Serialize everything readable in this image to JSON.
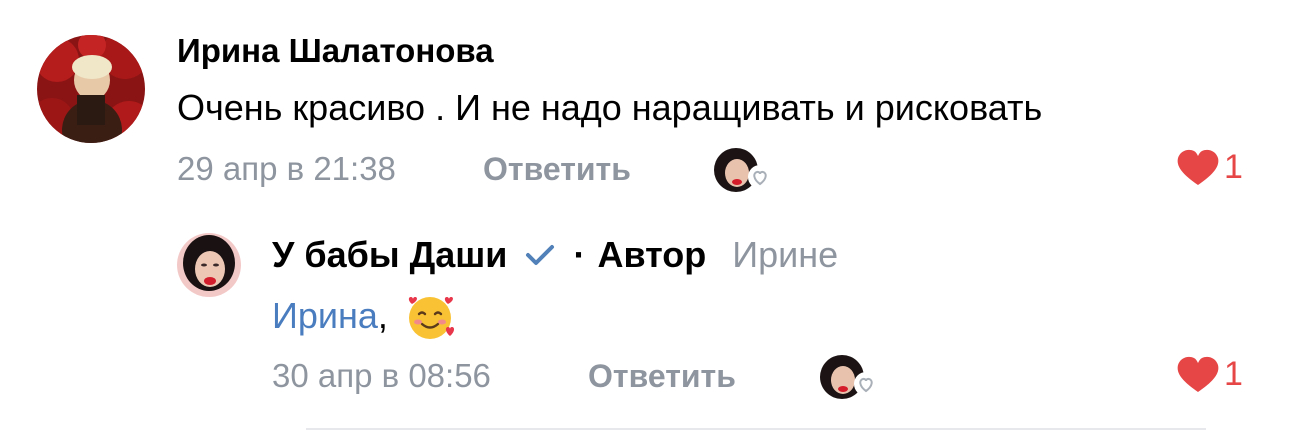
{
  "comment": {
    "author": "Ирина Шалатонова",
    "text": "Очень красиво . И не надо наращивать и рисковать",
    "time": "29 апр в 21:38",
    "reply_label": "Ответить",
    "likes": "1"
  },
  "reply": {
    "author": "У бабы Даши",
    "separator": "·",
    "author_badge": "Автор",
    "addressee": "Ирине",
    "mention": "Ирина",
    "text_suffix": ",",
    "emoji": "smiling-face-with-hearts",
    "time": "30 апр в 08:56",
    "reply_label": "Ответить",
    "likes": "1"
  },
  "colors": {
    "secondary_text": "#8e959f",
    "link": "#4a7dbf",
    "like": "#e64646",
    "verified": "#5181b8"
  }
}
